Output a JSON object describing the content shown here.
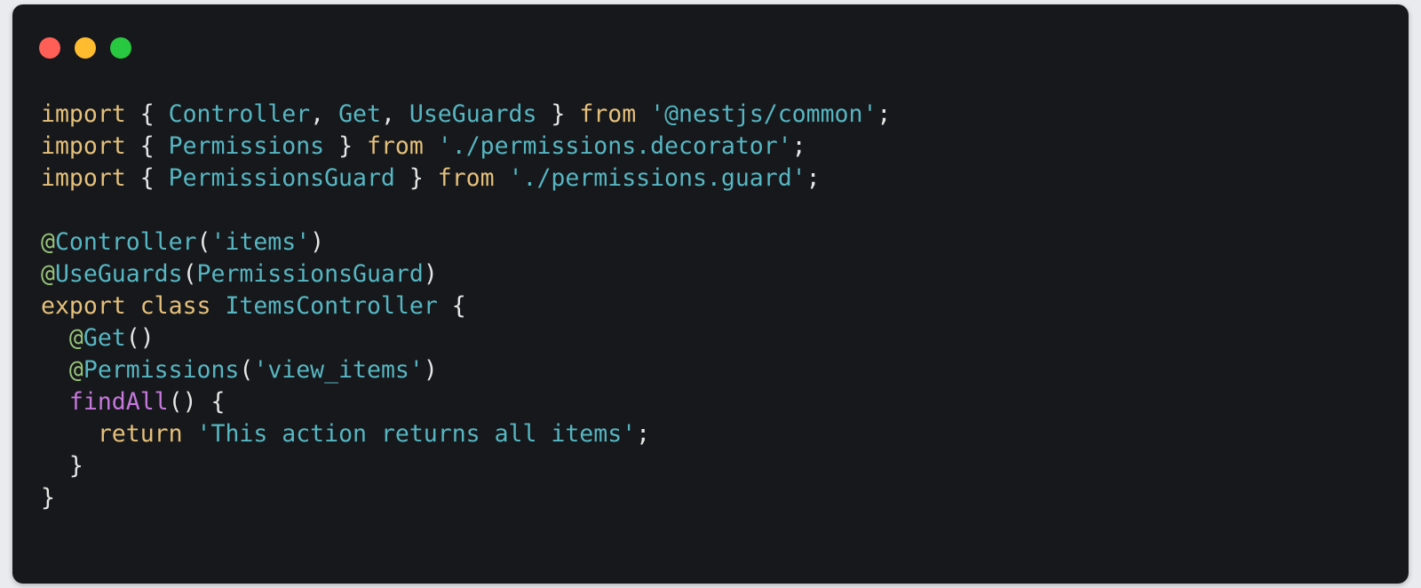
{
  "window": {
    "controls": [
      {
        "name": "close",
        "color": "#ff5f57"
      },
      {
        "name": "minimize",
        "color": "#febc2e"
      },
      {
        "name": "maximize",
        "color": "#28c840"
      }
    ]
  },
  "colors": {
    "keyword": "#e5c07b",
    "identifier": "#56b6c2",
    "string": "#56b6c2",
    "punctuation": "#e6e6e6",
    "decorator_at": "#98c379",
    "method": "#c678dd"
  },
  "code": {
    "language": "typescript",
    "lines": [
      [
        {
          "t": "import",
          "k": "keyword"
        },
        {
          "t": " { ",
          "k": "punctuation"
        },
        {
          "t": "Controller",
          "k": "identifier"
        },
        {
          "t": ", ",
          "k": "punctuation"
        },
        {
          "t": "Get",
          "k": "identifier"
        },
        {
          "t": ", ",
          "k": "punctuation"
        },
        {
          "t": "UseGuards",
          "k": "identifier"
        },
        {
          "t": " } ",
          "k": "punctuation"
        },
        {
          "t": "from",
          "k": "keyword"
        },
        {
          "t": " ",
          "k": "punctuation"
        },
        {
          "t": "'@nestjs/common'",
          "k": "string"
        },
        {
          "t": ";",
          "k": "punctuation"
        }
      ],
      [
        {
          "t": "import",
          "k": "keyword"
        },
        {
          "t": " { ",
          "k": "punctuation"
        },
        {
          "t": "Permissions",
          "k": "identifier"
        },
        {
          "t": " } ",
          "k": "punctuation"
        },
        {
          "t": "from",
          "k": "keyword"
        },
        {
          "t": " ",
          "k": "punctuation"
        },
        {
          "t": "'./permissions.decorator'",
          "k": "string"
        },
        {
          "t": ";",
          "k": "punctuation"
        }
      ],
      [
        {
          "t": "import",
          "k": "keyword"
        },
        {
          "t": " { ",
          "k": "punctuation"
        },
        {
          "t": "PermissionsGuard",
          "k": "identifier"
        },
        {
          "t": " } ",
          "k": "punctuation"
        },
        {
          "t": "from",
          "k": "keyword"
        },
        {
          "t": " ",
          "k": "punctuation"
        },
        {
          "t": "'./permissions.guard'",
          "k": "string"
        },
        {
          "t": ";",
          "k": "punctuation"
        }
      ],
      [],
      [
        {
          "t": "@",
          "k": "decorator_at"
        },
        {
          "t": "Controller",
          "k": "identifier"
        },
        {
          "t": "(",
          "k": "punctuation"
        },
        {
          "t": "'items'",
          "k": "string"
        },
        {
          "t": ")",
          "k": "punctuation"
        }
      ],
      [
        {
          "t": "@",
          "k": "decorator_at"
        },
        {
          "t": "UseGuards",
          "k": "identifier"
        },
        {
          "t": "(",
          "k": "punctuation"
        },
        {
          "t": "PermissionsGuard",
          "k": "identifier"
        },
        {
          "t": ")",
          "k": "punctuation"
        }
      ],
      [
        {
          "t": "export",
          "k": "keyword"
        },
        {
          "t": " ",
          "k": "punctuation"
        },
        {
          "t": "class",
          "k": "keyword"
        },
        {
          "t": " ",
          "k": "punctuation"
        },
        {
          "t": "ItemsController",
          "k": "identifier"
        },
        {
          "t": " {",
          "k": "punctuation"
        }
      ],
      [
        {
          "t": "  ",
          "k": "punctuation"
        },
        {
          "t": "@",
          "k": "decorator_at"
        },
        {
          "t": "Get",
          "k": "identifier"
        },
        {
          "t": "()",
          "k": "punctuation"
        }
      ],
      [
        {
          "t": "  ",
          "k": "punctuation"
        },
        {
          "t": "@",
          "k": "decorator_at"
        },
        {
          "t": "Permissions",
          "k": "identifier"
        },
        {
          "t": "(",
          "k": "punctuation"
        },
        {
          "t": "'view_items'",
          "k": "string"
        },
        {
          "t": ")",
          "k": "punctuation"
        }
      ],
      [
        {
          "t": "  ",
          "k": "punctuation"
        },
        {
          "t": "findAll",
          "k": "method"
        },
        {
          "t": "() {",
          "k": "punctuation"
        }
      ],
      [
        {
          "t": "    ",
          "k": "punctuation"
        },
        {
          "t": "return",
          "k": "keyword"
        },
        {
          "t": " ",
          "k": "punctuation"
        },
        {
          "t": "'This action returns all items'",
          "k": "string"
        },
        {
          "t": ";",
          "k": "punctuation"
        }
      ],
      [
        {
          "t": "  }",
          "k": "punctuation"
        }
      ],
      [
        {
          "t": "}",
          "k": "punctuation"
        }
      ]
    ]
  }
}
